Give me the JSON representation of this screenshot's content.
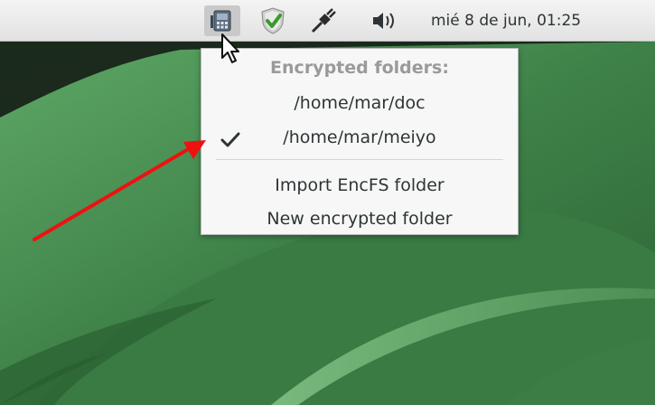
{
  "top_bar": {
    "clock_text": "mié  8 de jun, 01:25",
    "tray_icons": [
      "encfs-tray-icon",
      "shield-check-icon",
      "network-plug-icon",
      "volume-icon"
    ]
  },
  "menu": {
    "header": "Encrypted folders:",
    "folders": [
      {
        "label": "/home/mar/doc",
        "checked": false
      },
      {
        "label": "/home/mar/meiyo",
        "checked": true
      }
    ],
    "actions": {
      "import": "Import EncFS folder",
      "new": "New encrypted folder"
    }
  },
  "colors": {
    "annotation_arrow": "#ee1111",
    "menu_background": "#f7f7f7",
    "header_text": "#9a9a9a",
    "topbar_background": "#e8e8e8",
    "desktop_green": "#3f7e49"
  }
}
